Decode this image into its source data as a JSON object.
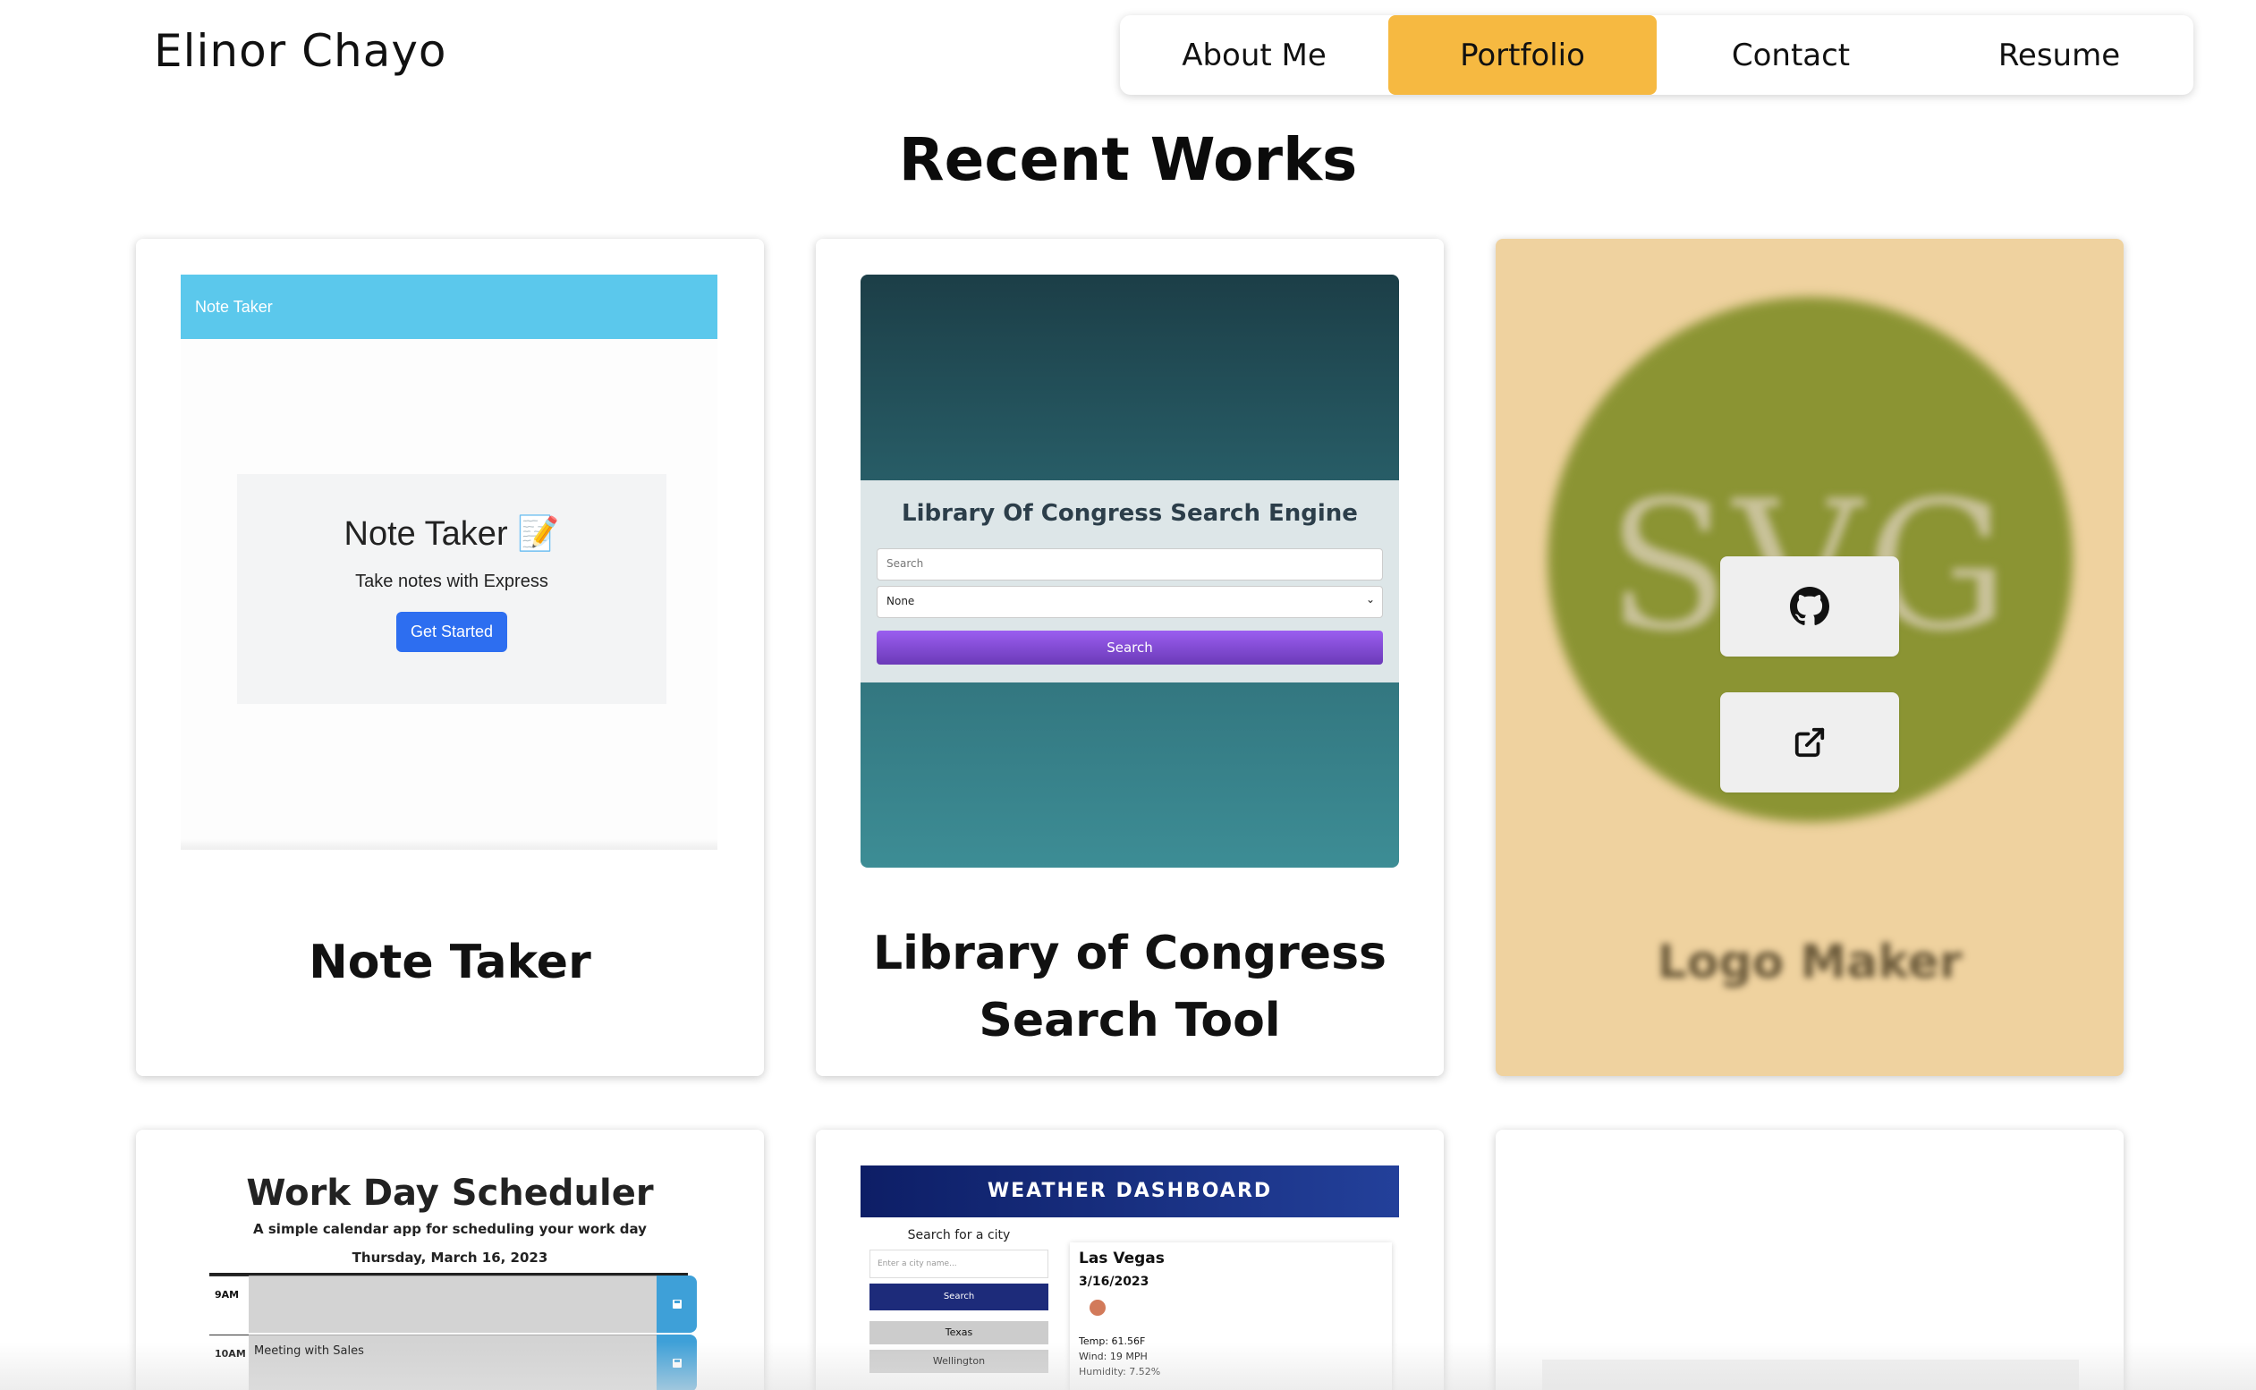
{
  "header": {
    "site_name": "Elinor Chayo",
    "nav": [
      "About Me",
      "Portfolio",
      "Contact",
      "Resume"
    ],
    "active": "Portfolio"
  },
  "section": {
    "title": "Recent Works"
  },
  "projects": [
    {
      "title": "Note Taker",
      "preview": {
        "bar_label": "Note Taker",
        "panel_title": "Note Taker 📝",
        "panel_subtitle": "Take notes with Express",
        "button_label": "Get Started"
      }
    },
    {
      "title_line1": "Library of Congress",
      "title_line2": "Search Tool",
      "preview": {
        "title": "Library Of Congress Search Engine",
        "search_placeholder": "Search",
        "select_value": "None",
        "button_label": "Search"
      }
    },
    {
      "title": "Logo Maker",
      "preview": {
        "logo_text": "SVG"
      },
      "hover_icons": [
        "github-icon",
        "external-link-icon"
      ]
    },
    {
      "preview": {
        "title": "Work Day Scheduler",
        "subtitle": "A simple calendar app for scheduling your work day",
        "date": "Thursday, March 16, 2023",
        "rows": [
          {
            "hour": "9AM",
            "text": ""
          },
          {
            "hour": "10AM",
            "text": "Meeting with Sales"
          }
        ]
      }
    },
    {
      "preview": {
        "header": "WEATHER DASHBOARD",
        "search_label": "Search for a city",
        "input_placeholder": "Enter a city name...",
        "search_button": "Search",
        "history": [
          "Texas",
          "Wellington"
        ],
        "city": "Las Vegas",
        "date": "3/16/2023",
        "temp": "Temp: 61.56F",
        "wind": "Wind: 19 MPH",
        "humidity": "Humidity: 7.52%"
      }
    },
    {}
  ],
  "colors": {
    "accent": "#f6b941",
    "note_taker_bar": "#5bc8ec",
    "logo_card_bg": "#efd29f",
    "logo_circle": "#8b9433"
  }
}
